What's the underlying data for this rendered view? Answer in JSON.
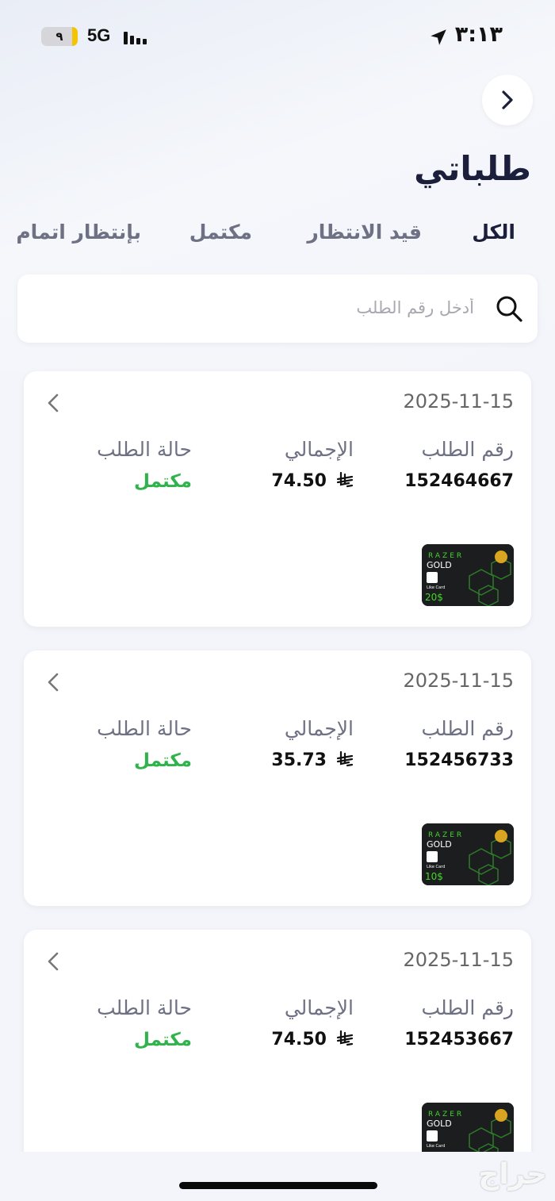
{
  "status_bar": {
    "battery_level": "٩",
    "battery_fraction": 0.15,
    "network": "5G",
    "time": "٣:١٣"
  },
  "header": {
    "back_icon": "chevron-right-icon",
    "title": "طلباتي"
  },
  "tabs": [
    {
      "label": "الكل",
      "active": true
    },
    {
      "label": "قيد الانتظار",
      "active": false
    },
    {
      "label": "مكتمل",
      "active": false
    },
    {
      "label": "بإنتظار اتمام",
      "active": false
    }
  ],
  "search": {
    "placeholder": "أدخل رقم الطلب",
    "value": ""
  },
  "labels": {
    "order_number": "رقم الطلب",
    "total": "الإجمالي",
    "status": "حالة الطلب"
  },
  "orders": [
    {
      "date": "2025-11-15",
      "order_number": "152464667",
      "total": "74.50",
      "status": "مكتمل",
      "product": {
        "brand": "RAZER",
        "line": "GOLD",
        "vendor": "Like Card",
        "amount": "20$"
      }
    },
    {
      "date": "2025-11-15",
      "order_number": "152456733",
      "total": "35.73",
      "status": "مكتمل",
      "product": {
        "brand": "RAZER",
        "line": "GOLD",
        "vendor": "Like Card",
        "amount": "10$"
      }
    },
    {
      "date": "2025-11-15",
      "order_number": "152453667",
      "total": "74.50",
      "status": "مكتمل",
      "product": {
        "brand": "RAZER",
        "line": "GOLD",
        "vendor": "Like Card",
        "amount": ""
      }
    }
  ],
  "watermark": "حراج",
  "colors": {
    "title": "#1b1f3b",
    "status_complete": "#2fb34a",
    "background": "#f3f5fa",
    "razer_green": "#44d62c"
  }
}
